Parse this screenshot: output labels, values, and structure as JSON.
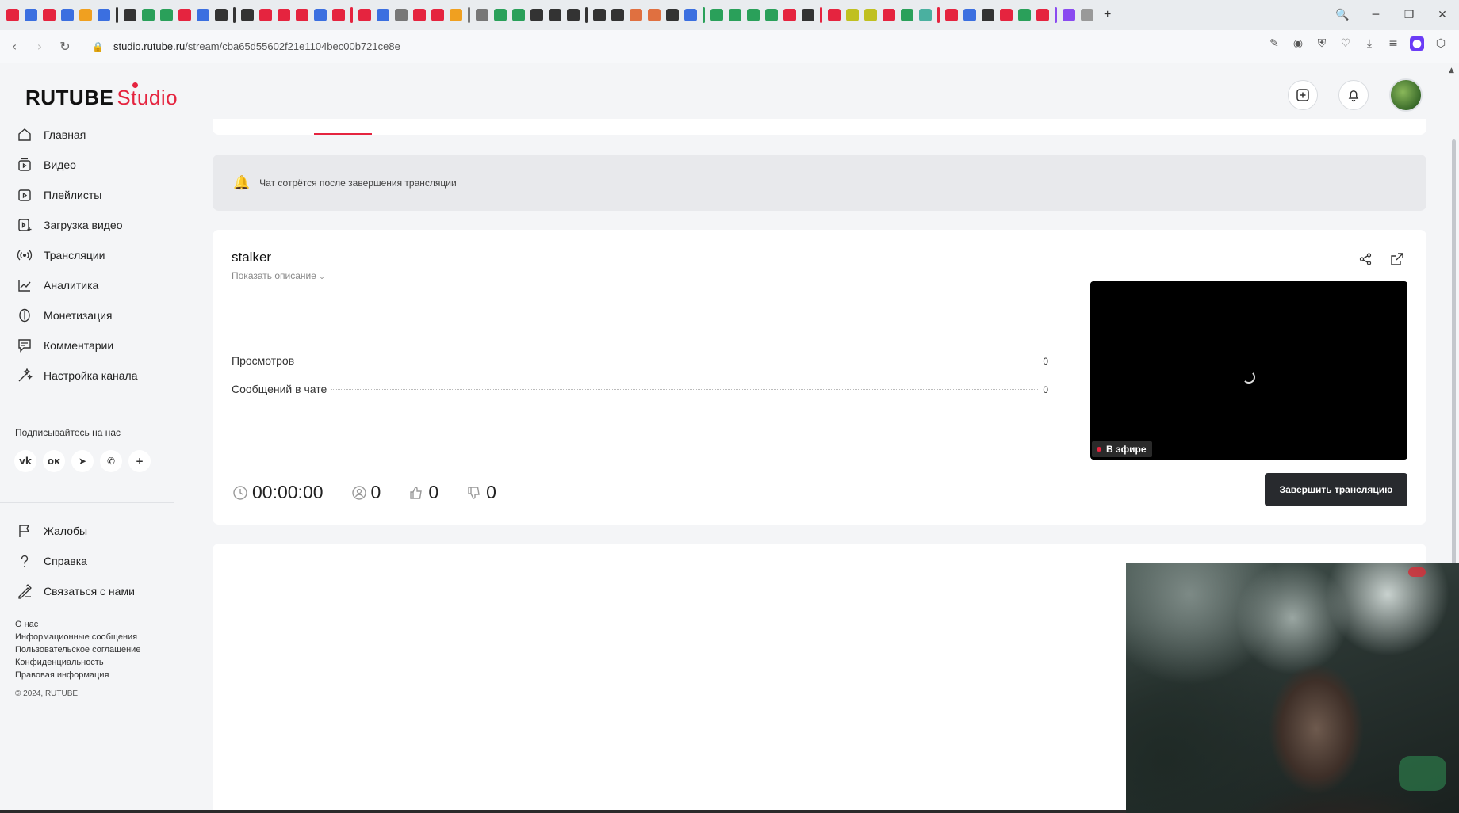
{
  "browser": {
    "url_host": "studio.rutube.ru",
    "url_path": "/stream/cba65d55602f21e1104bec00b721ce8e",
    "tab_icon_colors": [
      "#e5243f",
      "#3b6fe0",
      "#e5243f",
      "#3b6fe0",
      "#f0a020",
      "#3b6fe0",
      "#333333",
      "#2aa05a",
      "#2aa05a",
      "#e5243f",
      "#3b6fe0",
      "#333333",
      "#333333",
      "#e5243f",
      "#e5243f",
      "#e5243f",
      "#3b6fe0",
      "#e5243f",
      "#e5243f",
      "#3b6fe0",
      "#777777",
      "#e5243f",
      "#e5243f",
      "#f0a020",
      "#777777",
      "#2aa05a",
      "#2aa05a",
      "#333333",
      "#333333",
      "#333333",
      "#333333",
      "#333333",
      "#e07040",
      "#e07040",
      "#333333",
      "#3b6fe0",
      "#2aa05a",
      "#2aa05a",
      "#2aa05a",
      "#2aa05a",
      "#e5243f",
      "#333333",
      "#e5243f",
      "#c0c020",
      "#c0c020",
      "#e5243f",
      "#2aa05a",
      "#4ab0a0",
      "#e5243f",
      "#3b6fe0",
      "#333333",
      "#e5243f",
      "#2aa05a",
      "#e5243f",
      "#8a4af0",
      "#999999"
    ],
    "window_controls": [
      "🔍",
      "─",
      "❐",
      "✕"
    ],
    "new_tab_label": "+"
  },
  "header": {
    "logo_main": "RUTUBE",
    "logo_suffix": "Studio",
    "upload_icon": "plus-square-icon",
    "notifications_icon": "bell-icon"
  },
  "sidebar": {
    "items": [
      {
        "label": "Главная",
        "icon": "home-icon"
      },
      {
        "label": "Видео",
        "icon": "video-icon"
      },
      {
        "label": "Плейлисты",
        "icon": "playlist-icon"
      },
      {
        "label": "Загрузка видео",
        "icon": "upload-video-icon"
      },
      {
        "label": "Трансляции",
        "icon": "broadcast-icon"
      },
      {
        "label": "Аналитика",
        "icon": "analytics-icon"
      },
      {
        "label": "Монетизация",
        "icon": "monetization-icon"
      },
      {
        "label": "Комментарии",
        "icon": "comments-icon"
      },
      {
        "label": "Настройка канала",
        "icon": "channel-settings-icon"
      }
    ],
    "social_title": "Подписывайтесь на нас",
    "social_links": [
      {
        "glyph": "vk",
        "icon": "vk-icon"
      },
      {
        "glyph": "ок",
        "icon": "odnoklassniki-icon"
      },
      {
        "glyph": "➤",
        "icon": "telegram-icon"
      },
      {
        "glyph": "✆",
        "icon": "viber-icon"
      },
      {
        "glyph": "+",
        "icon": "more-icon"
      }
    ],
    "bottom_items": [
      {
        "label": "Жалобы",
        "icon": "flag-icon"
      },
      {
        "label": "Справка",
        "icon": "help-icon"
      },
      {
        "label": "Связаться с нами",
        "icon": "contact-icon"
      }
    ],
    "footer_links": [
      "О нас",
      "Информационные сообщения",
      "Пользовательское соглашение",
      "Конфиденциальность",
      "Правовая информация"
    ],
    "copyright": "© 2024, RUTUBE"
  },
  "notice": {
    "text": "Чат сотрётся после завершения трансляции"
  },
  "stream": {
    "title": "stalker",
    "show_description": "Показать описание",
    "stats": [
      {
        "label": "Просмотров",
        "value": "0"
      },
      {
        "label": "Сообщений в чате",
        "value": "0"
      }
    ],
    "live_badge": "В эфире",
    "counters": {
      "duration": "00:00:00",
      "viewers": "0",
      "likes": "0",
      "dislikes": "0"
    },
    "end_button": "Завершить трансляцию"
  }
}
